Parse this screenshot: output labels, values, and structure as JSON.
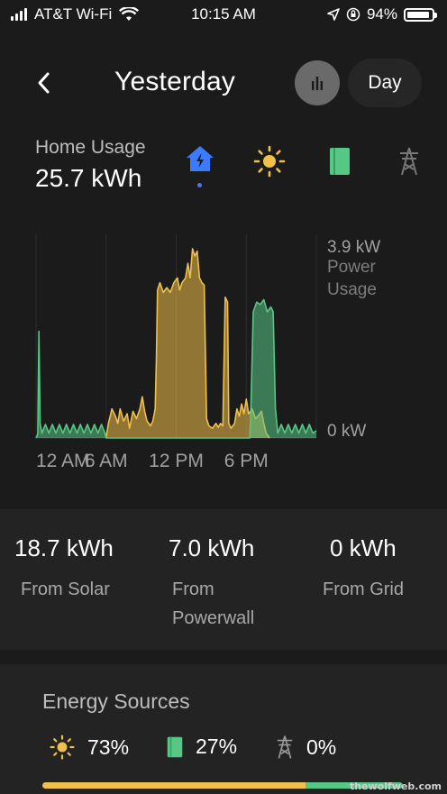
{
  "status_bar": {
    "carrier": "AT&T Wi-Fi",
    "time": "10:15 AM",
    "battery": "94%",
    "battery_level": 0.94
  },
  "header": {
    "title": "Yesterday",
    "range_button": "Day"
  },
  "usage": {
    "label": "Home Usage",
    "value": "25.7 kWh"
  },
  "source_icons": [
    "house-icon",
    "sun-icon",
    "powerwall-icon",
    "grid-tower-icon"
  ],
  "chart_data": {
    "type": "area",
    "x_tick_labels": [
      "12 AM",
      "6 AM",
      "12 PM",
      "6 PM"
    ],
    "y_max_label": "3.9 kW",
    "y_label_1": "Power",
    "y_label_2": "Usage",
    "y_min_label": "0 kW",
    "ylim": [
      0,
      3.9
    ],
    "xlim_hours": [
      0,
      24
    ],
    "series": [
      {
        "color": "#f0c04a",
        "points": [
          [
            6,
            0
          ],
          [
            6.2,
            0.3
          ],
          [
            6.5,
            0.6
          ],
          [
            6.8,
            0.45
          ],
          [
            7,
            0.3
          ],
          [
            7.2,
            0.6
          ],
          [
            7.5,
            0.35
          ],
          [
            7.8,
            0.5
          ],
          [
            8,
            0.2
          ],
          [
            8.3,
            0.55
          ],
          [
            8.6,
            0.4
          ],
          [
            8.9,
            0.6
          ],
          [
            9.1,
            0.85
          ],
          [
            9.3,
            0.55
          ],
          [
            9.5,
            0.35
          ],
          [
            9.8,
            0.25
          ],
          [
            10,
            0.35
          ],
          [
            10.2,
            0.6
          ],
          [
            10.3,
            1.6
          ],
          [
            10.4,
            3.05
          ],
          [
            10.6,
            3.2
          ],
          [
            10.9,
            3.0
          ],
          [
            11.2,
            3.1
          ],
          [
            11.5,
            3.0
          ],
          [
            11.8,
            3.2
          ],
          [
            12.1,
            3.3
          ],
          [
            12.3,
            3.05
          ],
          [
            12.5,
            3.2
          ],
          [
            12.8,
            3.3
          ],
          [
            13,
            3.6
          ],
          [
            13.2,
            3.3
          ],
          [
            13.4,
            3.9
          ],
          [
            13.6,
            3.75
          ],
          [
            13.8,
            3.85
          ],
          [
            14,
            3.3
          ],
          [
            14.2,
            3.2
          ],
          [
            14.4,
            3.15
          ],
          [
            14.6,
            0.4
          ],
          [
            14.8,
            0.25
          ],
          [
            15.1,
            0.2
          ],
          [
            15.4,
            0.3
          ],
          [
            15.6,
            0.22
          ],
          [
            15.8,
            0.3
          ],
          [
            16,
            0.25
          ],
          [
            16.2,
            2.9
          ],
          [
            16.4,
            2.8
          ],
          [
            16.5,
            0.3
          ],
          [
            16.7,
            0.2
          ],
          [
            17,
            0.3
          ],
          [
            17.2,
            0.6
          ],
          [
            17.4,
            0.45
          ],
          [
            17.6,
            0.7
          ],
          [
            17.8,
            0.5
          ],
          [
            18,
            0.8
          ],
          [
            18.2,
            0.5
          ],
          [
            18.5,
            0.6
          ],
          [
            18.8,
            0.4
          ],
          [
            19,
            0.45
          ],
          [
            19.3,
            0.55
          ],
          [
            19.5,
            0.3
          ],
          [
            19.7,
            0.1
          ],
          [
            20,
            0
          ]
        ]
      },
      {
        "color": "#57c785",
        "points": [
          [
            0,
            0
          ],
          [
            0.15,
            0.08
          ],
          [
            0.25,
            2.2
          ],
          [
            0.35,
            0.3
          ],
          [
            0.5,
            0.1
          ],
          [
            0.8,
            0.28
          ],
          [
            1.1,
            0.1
          ],
          [
            1.4,
            0.28
          ],
          [
            1.7,
            0.1
          ],
          [
            2,
            0.28
          ],
          [
            2.3,
            0.1
          ],
          [
            2.6,
            0.28
          ],
          [
            2.9,
            0.1
          ],
          [
            3.2,
            0.28
          ],
          [
            3.5,
            0.1
          ],
          [
            3.8,
            0.28
          ],
          [
            4.1,
            0.1
          ],
          [
            4.4,
            0.28
          ],
          [
            4.7,
            0.1
          ],
          [
            5,
            0.28
          ],
          [
            5.3,
            0.1
          ],
          [
            5.6,
            0.28
          ],
          [
            5.9,
            0.1
          ],
          [
            6,
            0
          ],
          [
            18.3,
            0
          ],
          [
            18.4,
            0.6
          ],
          [
            18.6,
            2.6
          ],
          [
            18.9,
            2.8
          ],
          [
            19.2,
            2.75
          ],
          [
            19.5,
            2.85
          ],
          [
            19.8,
            2.6
          ],
          [
            20.1,
            2.7
          ],
          [
            20.3,
            2.6
          ],
          [
            20.5,
            0.6
          ],
          [
            20.7,
            0.1
          ],
          [
            21,
            0.28
          ],
          [
            21.3,
            0.1
          ],
          [
            21.6,
            0.28
          ],
          [
            21.9,
            0.1
          ],
          [
            22.2,
            0.28
          ],
          [
            22.5,
            0.1
          ],
          [
            22.8,
            0.28
          ],
          [
            23.1,
            0.1
          ],
          [
            23.4,
            0.28
          ],
          [
            23.7,
            0.1
          ],
          [
            24,
            0.15
          ]
        ]
      }
    ]
  },
  "summary": [
    {
      "value": "18.7 kWh",
      "label": "From Solar"
    },
    {
      "value": "7.0 kWh",
      "label_1": "From",
      "label_2": "Powerwall"
    },
    {
      "value": "0 kWh",
      "label": "From Grid"
    }
  ],
  "energy_sources": {
    "title": "Energy Sources",
    "items": [
      {
        "icon": "sun-icon",
        "percent": "73%",
        "fraction": 0.73,
        "color": "#f0c04a"
      },
      {
        "icon": "powerwall-icon",
        "percent": "27%",
        "fraction": 0.27,
        "color": "#57c785"
      },
      {
        "icon": "grid-tower-icon",
        "percent": "0%",
        "fraction": 0.0,
        "color": "#888888"
      }
    ]
  },
  "watermark": "thewolfweb.com",
  "colors": {
    "solar": "#f0c04a",
    "powerwall": "#57c785",
    "active": "#3a7bff",
    "background": "#1b1b1b"
  }
}
